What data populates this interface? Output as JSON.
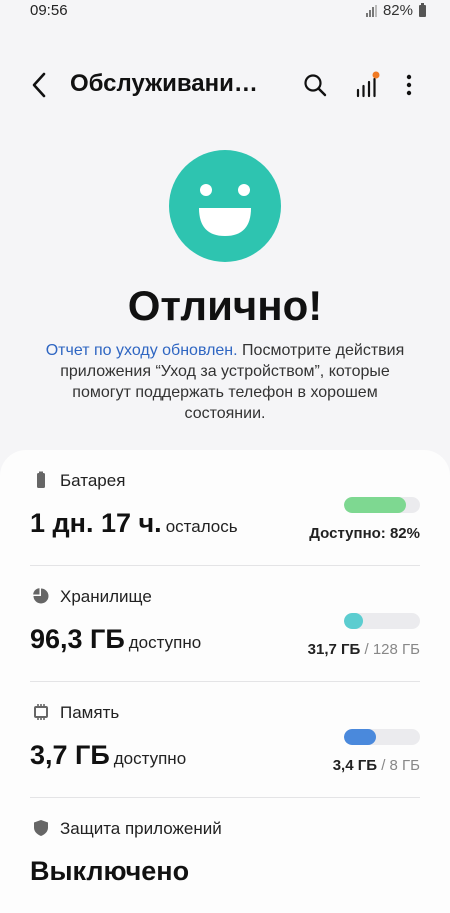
{
  "status_bar": {
    "time": "09:56",
    "battery_percent": "82%"
  },
  "app_bar": {
    "title": "Обслуживани…"
  },
  "icons": {
    "back": "chevron-left-icon",
    "search": "search-icon",
    "stats": "bar-chart-icon",
    "more": "more-vertical-icon",
    "face": "smiley-face-icon"
  },
  "colors": {
    "accent": "#2ec4b0",
    "link": "#2f66c2",
    "battery_bar": "#7ed891",
    "storage_bar": "#5ccdd0",
    "memory_bar": "#4a89dc",
    "notification_dot": "#f07a24"
  },
  "status": {
    "headline": "Отлично!",
    "desc_link": "Отчет по уходу обновлен.",
    "desc_text": " Посмотрите действия приложения “Уход за устройством”, которые помогут поддержать телефон в хорошем состоянии."
  },
  "battery": {
    "label": "Батарея",
    "value": "1 дн. 17 ч.",
    "suffix": "осталось",
    "right_text": "Доступно: 82%",
    "fill_fraction": 0.82
  },
  "storage": {
    "label": "Хранилище",
    "value": "96,3 ГБ",
    "suffix": "доступно",
    "used": "31,7 ГБ",
    "total": "/ 128 ГБ",
    "fill_fraction": 0.248
  },
  "memory": {
    "label": "Память",
    "value": "3,7 ГБ",
    "suffix": "доступно",
    "used": "3,4 ГБ",
    "total": "/ 8 ГБ",
    "fill_fraction": 0.425
  },
  "protection": {
    "label": "Защита приложений",
    "value": "Выключено"
  }
}
